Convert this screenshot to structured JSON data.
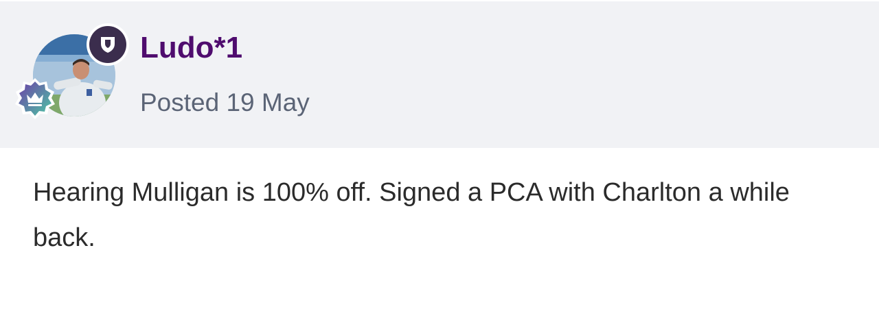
{
  "post": {
    "author": {
      "username": "Ludo*1",
      "avatar_icon": "user-photo-avatar",
      "role_badge_icon": "shield-icon",
      "rank_badge_icon": "crown-icon"
    },
    "date_label": "Posted 19 May",
    "content": "Hearing Mulligan is 100% off. Signed a PCA with Charlton a while back."
  },
  "colors": {
    "header_background": "#f1f2f5",
    "username": "#4f0c6e",
    "date_text": "#5b6476",
    "body_text": "#2b2b2b",
    "role_badge": "#3b2d4d",
    "rank_badge_gradient_start": "#6c3fa8",
    "rank_badge_gradient_end": "#4ec7a4"
  }
}
